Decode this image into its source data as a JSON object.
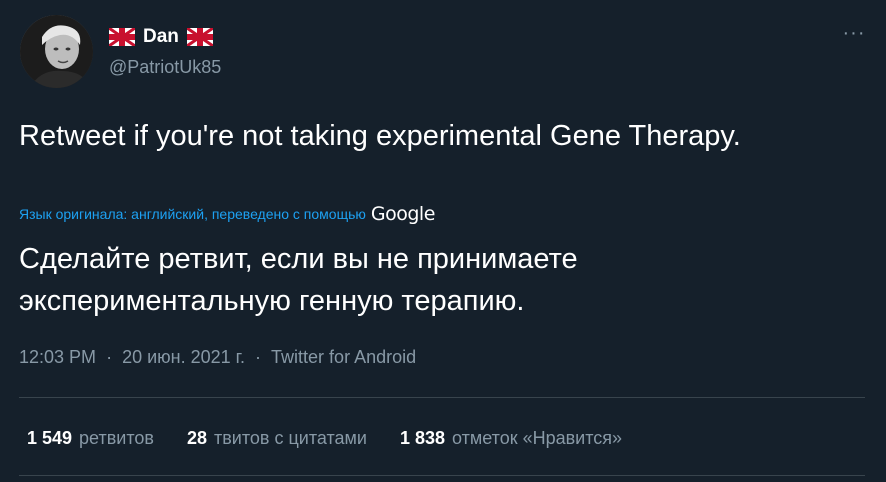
{
  "author": {
    "display_name": "Dan",
    "handle": "@PatriotUk85",
    "flag_icon": "uk-flag-icon"
  },
  "menu": {
    "more_label": "···"
  },
  "tweet": {
    "text": "Retweet if you're not taking experimental Gene Therapy.",
    "translation_note": "Язык оригинала: английский, переведено с помощью",
    "translation_provider": "Google",
    "translated_text": "Сделайте ретвит, если вы не принимаете экспериментальную генную терапию."
  },
  "meta": {
    "time": "12:03 PM",
    "separator": "·",
    "date": "20 июн. 2021 г.",
    "source": "Twitter for Android"
  },
  "stats": {
    "retweets_count": "1 549",
    "retweets_label": "ретвитов",
    "quotes_count": "28",
    "quotes_label": "твитов с цитатами",
    "likes_count": "1 838",
    "likes_label": "отметок «Нравится»"
  },
  "colors": {
    "background": "#15202b",
    "primary_text": "#ffffff",
    "secondary_text": "#8899a6",
    "link": "#1da1f2",
    "divider": "#38444d"
  }
}
